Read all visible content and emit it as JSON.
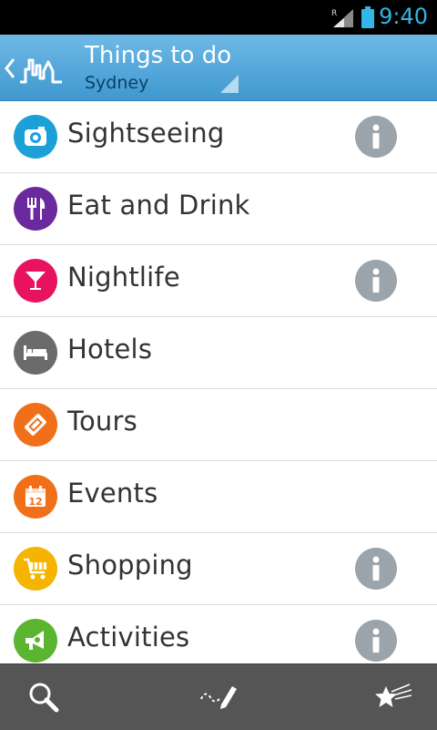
{
  "status_bar": {
    "time": "9:40",
    "signal_badge": "R",
    "accent": "#33b5e5"
  },
  "action_bar": {
    "title": "Things to do",
    "subtitle": "Sydney"
  },
  "categories": [
    {
      "label": "Sightseeing",
      "icon": "camera-icon",
      "color": "#1ba0d8",
      "info": true
    },
    {
      "label": "Eat and Drink",
      "icon": "fork-knife-icon",
      "color": "#6a2a9e",
      "info": false
    },
    {
      "label": "Nightlife",
      "icon": "cocktail-glass-icon",
      "color": "#e8135e",
      "info": true
    },
    {
      "label": "Hotels",
      "icon": "bed-icon",
      "color": "#6b6b6b",
      "info": false
    },
    {
      "label": "Tours",
      "icon": "ticket-icon",
      "color": "#f26f1a",
      "info": false
    },
    {
      "label": "Events",
      "icon": "calendar-icon",
      "color": "#f26f1a",
      "info": false,
      "icon_text": "12"
    },
    {
      "label": "Shopping",
      "icon": "shopping-cart-icon",
      "color": "#f5b400",
      "info": true
    },
    {
      "label": "Activities",
      "icon": "megaphone-icon",
      "color": "#5cb531",
      "info": true
    }
  ],
  "bottom_bar": {
    "items": [
      "search-icon",
      "trip-planner-icon",
      "favorites-icon"
    ]
  }
}
